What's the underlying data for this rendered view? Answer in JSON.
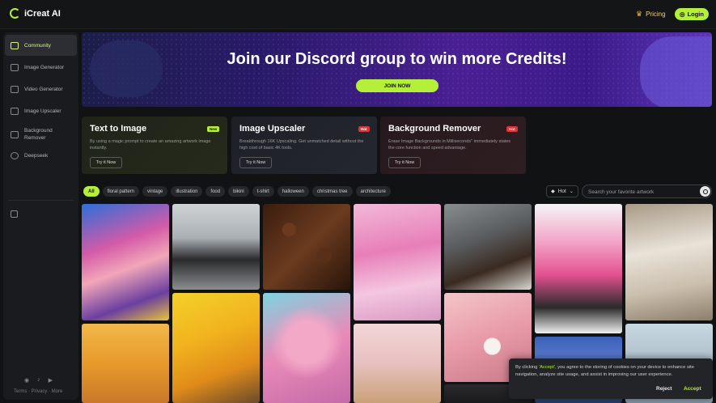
{
  "header": {
    "logo_text": "iCreat AI",
    "pricing_label": "Pricing",
    "login_label": "Login"
  },
  "sidebar": {
    "items": [
      {
        "label": "Community",
        "icon": "community-icon"
      },
      {
        "label": "Image Generator",
        "icon": "image-icon"
      },
      {
        "label": "Video Generator",
        "icon": "video-icon"
      },
      {
        "label": "Image Upscaler",
        "icon": "upscale-icon"
      },
      {
        "label": "Background Remover",
        "icon": "eraser-icon"
      },
      {
        "label": "Deepseek",
        "icon": "deepseek-icon"
      }
    ],
    "footer_links": "Terms · Privacy · More"
  },
  "banner": {
    "title": "Join our Discord group to win more Credits!",
    "button_label": "JOIN NOW"
  },
  "cards": [
    {
      "title": "Text to Image",
      "badge": "New",
      "desc": "By using a magic prompt to create an amazing artwork image instantly.",
      "button": "Try it Now"
    },
    {
      "title": "Image Upscaler",
      "badge": "Hot",
      "desc": "Breakthrough 16K Upscaling. Get unmatched detail without the high cost of basic 4K tools.",
      "button": "Try it Now"
    },
    {
      "title": "Background Remover",
      "badge": "Hot",
      "desc": "Erase Image Backgrounds in Milliseconds\" immediately states the core function and speed advantage.",
      "button": "Try it Now"
    }
  ],
  "tags": [
    "All",
    "floral pattern",
    "vintage",
    "illustration",
    "food",
    "bikini",
    "t-shirt",
    "halloween",
    "christmas tree",
    "architecture"
  ],
  "sort_label": "Hot",
  "search": {
    "placeholder": "Search your favorite artwork"
  },
  "cookie": {
    "text_before": "By clicking ",
    "highlight": "'Accept'",
    "text_after": ", you agree to the storing of cookies on your device to enhance site navigation, analyze site usage, and assist in improving our user experience.",
    "reject_label": "Reject",
    "accept_label": "Accept"
  },
  "colors": {
    "accent": "#b4f03a",
    "hot_badge": "#e0343a"
  }
}
